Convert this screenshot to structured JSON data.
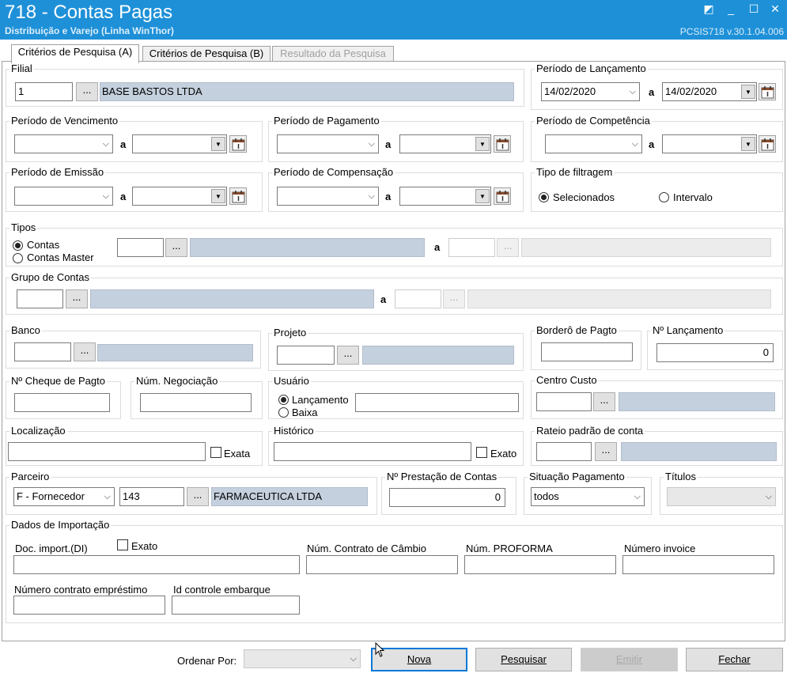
{
  "window": {
    "title": "718 - Contas Pagas",
    "subtitle": "Distribuição e Varejo (Linha WinThor)",
    "version": "PCSIS718  v.30.1.04.006"
  },
  "tabs": [
    {
      "label": "Critérios de Pesquisa (A)"
    },
    {
      "label": "Critérios de Pesquisa (B)"
    },
    {
      "label": "Resultado da Pesquisa"
    }
  ],
  "a": "a",
  "dots": "...",
  "filial": {
    "label": "Filial",
    "code": "1",
    "name": "BASE BASTOS LTDA"
  },
  "periodo_lancamento": {
    "label": "Período de Lançamento",
    "from": "14/02/2020",
    "to": "14/02/2020"
  },
  "periodo_vencimento": {
    "label": "Período de Vencimento"
  },
  "periodo_pagamento": {
    "label": "Período de Pagamento"
  },
  "periodo_competencia": {
    "label": "Período de Competência"
  },
  "periodo_emissao": {
    "label": "Período de Emissão"
  },
  "periodo_compensacao": {
    "label": "Período de Compensação"
  },
  "tipo_filtragem": {
    "label": "Tipo de filtragem",
    "opt1": "Selecionados",
    "opt2": "Intervalo"
  },
  "tipos": {
    "label": "Tipos",
    "opt1": "Contas",
    "opt2": "Contas Master"
  },
  "grupo_contas": {
    "label": "Grupo de Contas"
  },
  "banco": {
    "label": "Banco"
  },
  "projeto": {
    "label": "Projeto"
  },
  "bordero": {
    "label": "Borderô de Pagto"
  },
  "n_lancamento": {
    "label": "Nº Lançamento",
    "value": "0"
  },
  "n_cheque": {
    "label": "Nº Cheque de Pagto"
  },
  "num_negociacao": {
    "label": "Núm. Negociação"
  },
  "usuario": {
    "label": "Usuário",
    "opt1": "Lançamento",
    "opt2": "Baixa"
  },
  "centro_custo": {
    "label": "Centro Custo"
  },
  "localizacao": {
    "label": "Localização",
    "exata": "Exata"
  },
  "historico": {
    "label": "Histórico",
    "exata": "Exato"
  },
  "rateio": {
    "label": "Rateio padrão de conta"
  },
  "parceiro": {
    "label": "Parceiro",
    "tipo": "F - Fornecedor",
    "code": "143",
    "name": "FARMACEUTICA LTDA"
  },
  "n_prestacao": {
    "label": "Nº Prestação de Contas",
    "value": "0"
  },
  "situacao": {
    "label": "Situação Pagamento",
    "value": "todos"
  },
  "titulos": {
    "label": "Títulos"
  },
  "importacao": {
    "label": "Dados de Importação",
    "doc_label": "Doc. import.(DI)",
    "exato": "Exato",
    "contrato_cambio": "Núm. Contrato de Câmbio",
    "proforma": "Núm. PROFORMA",
    "invoice": "Número invoice",
    "contrato_emprestimo": "Número contrato empréstimo",
    "embarque": "Id controle embarque"
  },
  "bottom": {
    "ordenar_label": "Ordenar Por:",
    "nova": "Nova",
    "pesquisar": "Pesquisar",
    "emitir": "Emitir",
    "fechar": "Fechar"
  }
}
